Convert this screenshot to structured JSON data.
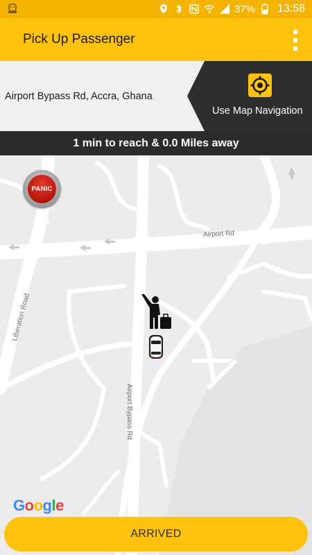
{
  "status_bar": {
    "battery_percent": "37%",
    "time": "13:58",
    "icons": [
      "app-notification-icon",
      "location-icon",
      "bluetooth-icon",
      "nfc-icon",
      "wifi-icon",
      "signal-icon",
      "battery-icon"
    ]
  },
  "app_bar": {
    "title": "Pick Up Passenger",
    "menu_icon": "overflow-menu-icon"
  },
  "pickup": {
    "address": "Airport Bypass Rd, Accra, Ghana",
    "navigation_label": "Use Map Navigation",
    "navigation_icon": "crosshair-target-icon"
  },
  "eta": {
    "text": "1 min to reach & 0.0 Miles away"
  },
  "map": {
    "road_labels": {
      "airport_rd": "Airport Rd",
      "liberation_road": "Liberation Road",
      "airport_bypass_rd": "Airport Bypass Rd"
    },
    "panic_label": "PANIC",
    "attribution": [
      "G",
      "o",
      "o",
      "g",
      "l",
      "e"
    ],
    "attribution_colors": [
      "#4285F4",
      "#EA4335",
      "#FBBC05",
      "#4285F4",
      "#34A853",
      "#EA4335"
    ]
  },
  "actions": {
    "arrived_label": "ARRIVED"
  },
  "colors": {
    "accent": "#ffc20e",
    "status_bar": "#f3b300",
    "dark": "#2b2b2b",
    "panic_red": "#c81a12"
  }
}
